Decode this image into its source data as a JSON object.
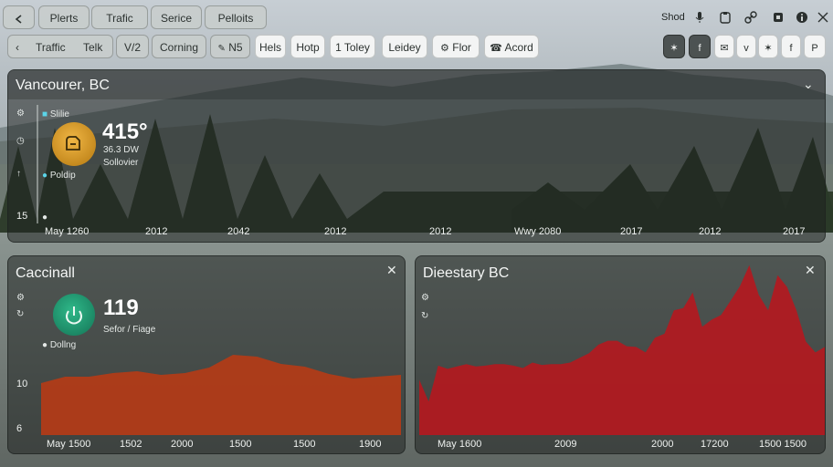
{
  "toolbar": {
    "row1": {
      "back_icon": "back-icon",
      "tabs": [
        "Plerts",
        "Trafic",
        "Serice",
        "Pelloits"
      ],
      "right_label": "Shod",
      "right_icons": [
        "mic-icon",
        "clipboard-icon",
        "link-icon",
        "grid-icon",
        "info-icon",
        "collapse-icon"
      ]
    },
    "row2": {
      "segment_left": "Traffic",
      "segment_right": "Telk",
      "view_label": "V/2",
      "config_label": "Corning",
      "n5_label": "N5",
      "chips": [
        "Hels",
        "Hotp",
        "1 Toley",
        "Leidey",
        "Flor",
        "Acord"
      ],
      "social": [
        "twitter-icon",
        "facebook-icon",
        "mail-icon",
        "v-icon",
        "twitter-icon",
        "f-icon",
        "pinterest-icon"
      ]
    }
  },
  "panels": {
    "top": {
      "title": "Vancourer, BC",
      "status_1": "Slilie",
      "temp": "415°",
      "desc_1": "36.3 DW",
      "desc_2": "Sollovier",
      "status_2": "Poldip",
      "left_ticks": [
        "15"
      ],
      "x_ticks": [
        "May 1260",
        "2012",
        "2042",
        "2012",
        "2012",
        "Wwy 2080",
        "2017",
        "2012",
        "2017"
      ]
    },
    "left": {
      "title": "Caccinall",
      "value": "119",
      "desc": "Sefor / Fiage",
      "status": "Dollng",
      "left_ticks": [
        "10",
        "6"
      ],
      "x_ticks": [
        "May 1500",
        "1502",
        "2000",
        "1500",
        "1500",
        "1900"
      ]
    },
    "right": {
      "title": "Dieestary BC",
      "x_ticks": [
        "May 1600",
        "2009",
        "2000",
        "17200",
        "1500 1500"
      ]
    }
  },
  "chart_data": [
    {
      "type": "area",
      "title": "Caccinall",
      "x": [
        "May 1500",
        "1502",
        "2000",
        "1500",
        "1500",
        "1900"
      ],
      "series": [
        {
          "values": [
            0.57,
            0.64,
            0.64,
            0.68,
            0.7,
            0.66,
            0.68,
            0.74,
            0.88,
            0.86,
            0.78,
            0.75,
            0.67,
            0.62,
            0.64,
            0.66
          ]
        }
      ],
      "color": "#b43b17"
    },
    {
      "type": "area",
      "title": "Dieestary BC",
      "x": [
        "May 1600",
        "2009",
        "2000",
        "17200",
        "1500 1500"
      ],
      "series": [
        {
          "values": [
            0.71,
            0.43,
            0.89,
            0.85,
            0.88,
            0.91,
            0.88,
            0.89,
            0.91,
            0.91,
            0.89,
            0.86,
            0.93,
            0.9,
            0.91,
            0.91,
            0.93,
            0.99,
            1.05,
            1.16,
            1.21,
            1.21,
            1.14,
            1.13,
            1.06,
            1.25,
            1.3,
            1.6,
            1.63,
            1.83,
            1.39,
            1.48,
            1.54,
            1.72,
            1.91,
            2.18,
            1.8,
            1.6,
            2.05,
            1.9,
            1.6,
            1.2,
            1.06,
            1.13
          ]
        }
      ],
      "color": "#b3191f"
    }
  ],
  "colors": {
    "panel_bg": "#1c201f",
    "accent_orange": "#d79a23",
    "accent_green": "#1f9a72",
    "area_left": "#b43b17",
    "area_right": "#b3191f"
  }
}
